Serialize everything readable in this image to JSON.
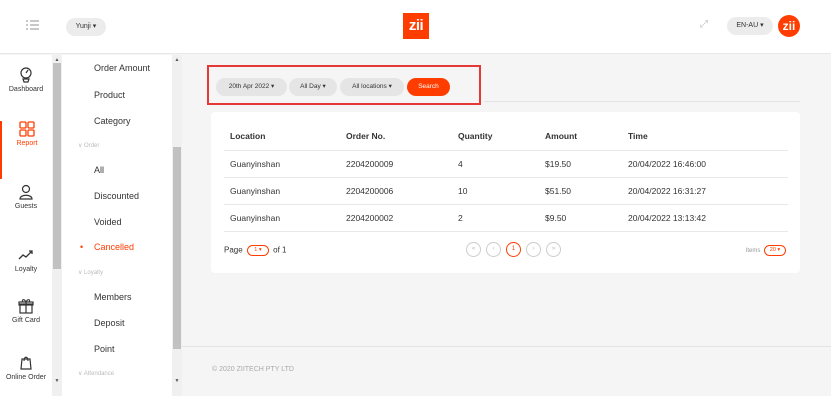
{
  "header": {
    "user": "Yunji ▾",
    "logo": "zii",
    "expand_icon": "expand-icon",
    "language": "EN-AU ▾",
    "logo_circle": "zii"
  },
  "rail": {
    "items": [
      {
        "label": "Dashboard",
        "icon": "dashboard-icon"
      },
      {
        "label": "Report",
        "icon": "report-icon"
      },
      {
        "label": "Guests",
        "icon": "guests-icon"
      },
      {
        "label": "Loyalty",
        "icon": "loyalty-icon"
      },
      {
        "label": "Gift Card",
        "icon": "gift-icon"
      },
      {
        "label": "Online Order",
        "icon": "online-order-icon"
      }
    ],
    "scroll_up": "▲",
    "scroll_down": "▼"
  },
  "submenu": {
    "items": [
      {
        "label": "Order Amount"
      },
      {
        "label": "Product"
      },
      {
        "label": "Category"
      },
      {
        "label": "∨ Order"
      },
      {
        "label": "All"
      },
      {
        "label": "Discounted"
      },
      {
        "label": "Voided"
      },
      {
        "label": "Cancelled"
      },
      {
        "label": "∨ Loyalty"
      },
      {
        "label": "Members"
      },
      {
        "label": "Deposit"
      },
      {
        "label": "Point"
      },
      {
        "label": "∨ Attendance"
      }
    ],
    "scroll_up": "▲",
    "scroll_down": "▼"
  },
  "filters": {
    "date": "20th Apr 2022 ▾",
    "day": "All Day ▾",
    "locations": "All locations ▾",
    "search": "Search"
  },
  "table": {
    "headers": [
      "Location",
      "Order No.",
      "Quantity",
      "Amount",
      "Time"
    ],
    "rows": [
      [
        "Guanyinshan",
        "2204200009",
        "4",
        "$19.50",
        "20/04/2022 16:46:00"
      ],
      [
        "Guanyinshan",
        "2204200006",
        "10",
        "$51.50",
        "20/04/2022 16:31:27"
      ],
      [
        "Guanyinshan",
        "2204200002",
        "2",
        "$9.50",
        "20/04/2022 13:13:42"
      ]
    ]
  },
  "pagination": {
    "page_label": "Page",
    "page_value": "1 ▾",
    "of_label": "of 1",
    "nav": [
      "«",
      "‹",
      "1",
      "›",
      "»"
    ],
    "items_label": "Items",
    "items_value": "20 ▾"
  },
  "footer": {
    "copyright": "© 2020 ZIITECH PTY LTD"
  },
  "colors": {
    "accent": "#ff3d00",
    "highlight_border": "#e53935"
  }
}
